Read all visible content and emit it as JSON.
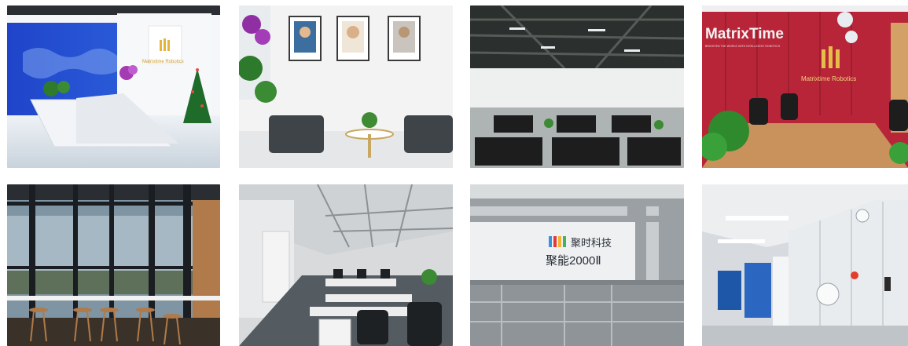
{
  "photos": [
    {
      "name": "reception-lobby",
      "sign_text": "Matrixtime Robotics",
      "colors": {
        "wall": "#1e3fb8",
        "floor": "#dfe6ee"
      }
    },
    {
      "name": "lounge-portraits",
      "colors": {
        "wall": "#f1f1f1",
        "floor": "#e8e8e8"
      }
    },
    {
      "name": "open-office-ceiling",
      "colors": {
        "ceiling": "#2b2f2d",
        "desk": "#1d1d1d"
      }
    },
    {
      "name": "meeting-room",
      "wall_text": "MatrixTime",
      "wall_tagline": "BRIGHTEN THE WORLD WITH INTELLIGENT ROBOTICS",
      "sign_text": "Matrixtime Robotics",
      "colors": {
        "wall": "#b82538",
        "table": "#c9925c"
      }
    },
    {
      "name": "window-bar-seating",
      "colors": {
        "frame": "#1a1d22",
        "glass": "#7f95a3"
      }
    },
    {
      "name": "office-workstations",
      "colors": {
        "floor": "#545b61",
        "ceiling": "#d8dadb"
      }
    },
    {
      "name": "machine-product",
      "brand_text": "聚时科技",
      "model_text": "聚能2000Ⅱ",
      "colors": {
        "frame": "#9aa0a3",
        "panel": "#eef0f1"
      }
    },
    {
      "name": "equipment-lab",
      "colors": {
        "cabinet": "#e9ecef",
        "accent": "#1f57a8"
      }
    }
  ]
}
